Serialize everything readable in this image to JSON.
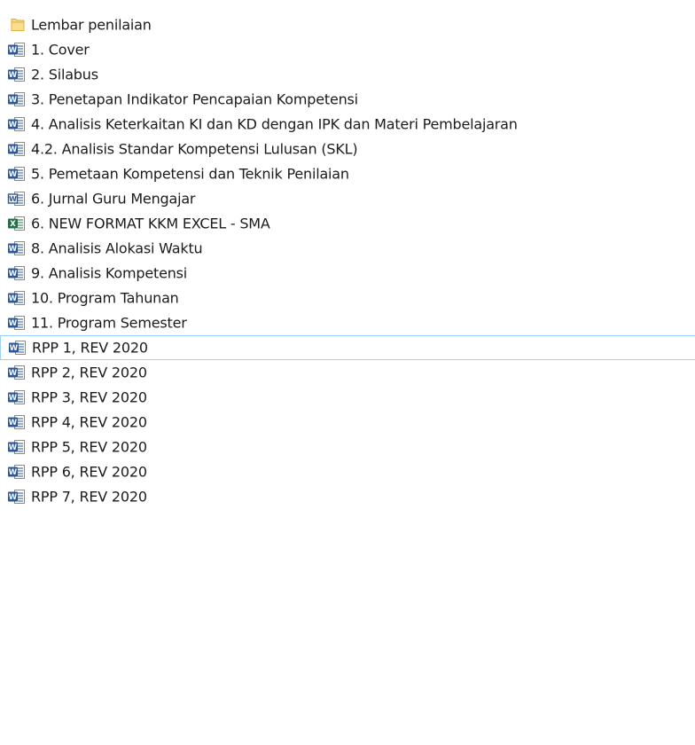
{
  "explorer": {
    "items": [
      {
        "name": "Lembar penilaian",
        "type": "folder"
      },
      {
        "name": "1. Cover",
        "type": "word"
      },
      {
        "name": "2. Silabus",
        "type": "word"
      },
      {
        "name": "3. Penetapan Indikator Pencapaian Kompetensi",
        "type": "word"
      },
      {
        "name": "4. Analisis Keterkaitan KI dan KD dengan IPK dan Materi Pembelajaran",
        "type": "word"
      },
      {
        "name": "4.2. Analisis Standar Kompetensi Lulusan (SKL)",
        "type": "word"
      },
      {
        "name": "5. Pemetaan Kompetensi dan Teknik Penilaian",
        "type": "word"
      },
      {
        "name": "6. Jurnal Guru Mengajar",
        "type": "word-legacy"
      },
      {
        "name": "6. NEW FORMAT KKM EXCEL - SMA",
        "type": "excel"
      },
      {
        "name": "8. Analisis Alokasi Waktu",
        "type": "word"
      },
      {
        "name": "9. Analisis Kompetensi",
        "type": "word"
      },
      {
        "name": "10. Program Tahunan",
        "type": "word"
      },
      {
        "name": "11. Program Semester",
        "type": "word"
      },
      {
        "name": "RPP 1, REV 2020",
        "type": "word",
        "focused": true
      },
      {
        "name": "RPP 2, REV 2020",
        "type": "word"
      },
      {
        "name": "RPP 3, REV 2020",
        "type": "word"
      },
      {
        "name": "RPP 4, REV 2020",
        "type": "word"
      },
      {
        "name": "RPP 5, REV 2020",
        "type": "word"
      },
      {
        "name": "RPP 6, REV 2020",
        "type": "word"
      },
      {
        "name": "RPP 7, REV 2020",
        "type": "word"
      }
    ]
  },
  "icons": {
    "folder": "folder-icon",
    "word": "word-document-icon",
    "word-legacy": "word-97-2003-document-icon",
    "excel": "excel-workbook-icon"
  },
  "colors": {
    "folder": "#f8d775",
    "word": "#2b579a",
    "excel": "#217346",
    "focus_border": "#99d1ff"
  }
}
